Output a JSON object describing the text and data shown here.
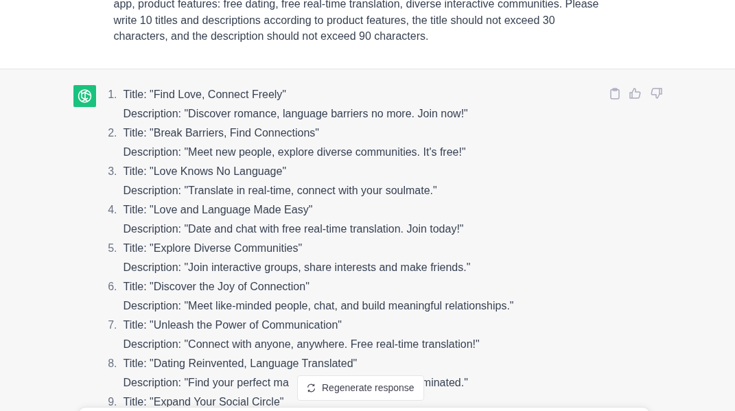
{
  "user_message": {
    "text": "app, product features: free dating, free real-time translation, diverse interactive communities. Please write 10 titles and descriptions according to product features, the title should not exceed 30 characters, and the description should not exceed 90 characters."
  },
  "response": {
    "items": [
      {
        "number": "1.",
        "title": "Title: \"Find Love, Connect Freely\"",
        "description": "Description: \"Discover romance, language barriers no more. Join now!\""
      },
      {
        "number": "2.",
        "title": "Title: \"Break Barriers, Find Connections\"",
        "description": "Description: \"Meet new people, explore diverse communities. It's free!\""
      },
      {
        "number": "3.",
        "title": "Title: \"Love Knows No Language\"",
        "description": "Description: \"Translate in real-time, connect with your soulmate.\""
      },
      {
        "number": "4.",
        "title": "Title: \"Love and Language Made Easy\"",
        "description": "Description: \"Date and chat with free real-time translation. Join today!\""
      },
      {
        "number": "5.",
        "title": "Title: \"Explore Diverse Communities\"",
        "description": "Description: \"Join interactive groups, share interests and make friends.\""
      },
      {
        "number": "6.",
        "title": "Title: \"Discover the Joy of Connection\"",
        "description": "Description: \"Meet like-minded people, chat, and build meaningful relationships.\""
      },
      {
        "number": "7.",
        "title": "Title: \"Unleash the Power of Communication\"",
        "description": "Description: \"Connect with anyone, anywhere. Free real-time translation!\""
      },
      {
        "number": "8.",
        "title": "Title: \"Dating Reinvented, Language Translated\"",
        "description": "Description: \"Find your perfect ma",
        "description_end": "minated.\""
      },
      {
        "number": "9.",
        "title": "Title: \"Expand Your Social Circle\""
      }
    ]
  },
  "regenerate_button": {
    "label": "Regenerate response"
  }
}
